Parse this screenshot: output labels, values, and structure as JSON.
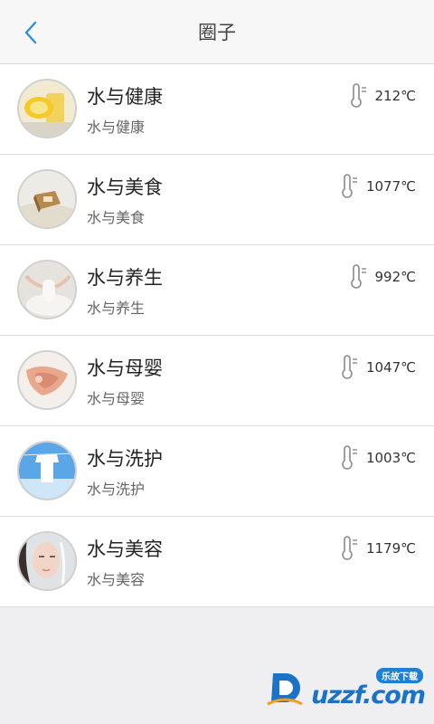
{
  "header": {
    "title": "圈子",
    "back_icon": "chevron-left-icon",
    "accent": "#2f8fe0"
  },
  "items": [
    {
      "title": "水与健康",
      "subtitle": "水与健康",
      "temperature": "212℃",
      "avatar": "lemon-juice"
    },
    {
      "title": "水与美食",
      "subtitle": "水与美食",
      "temperature": "1077℃",
      "avatar": "food-box"
    },
    {
      "title": "水与养生",
      "subtitle": "水与养生",
      "temperature": "992℃",
      "avatar": "yoga"
    },
    {
      "title": "水与母婴",
      "subtitle": "水与母婴",
      "temperature": "1047℃",
      "avatar": "hands"
    },
    {
      "title": "水与洗护",
      "subtitle": "水与洗护",
      "temperature": "1003℃",
      "avatar": "laundry"
    },
    {
      "title": "水与美容",
      "subtitle": "水与美容",
      "temperature": "1179℃",
      "avatar": "face"
    }
  ],
  "watermark": {
    "tag": "乐故下载",
    "text": "uzzf.com"
  }
}
